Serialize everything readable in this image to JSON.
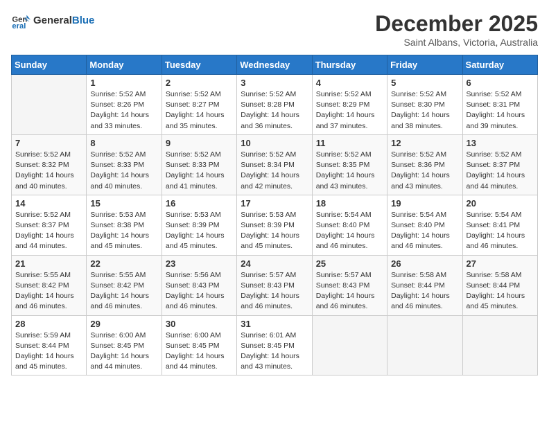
{
  "header": {
    "logo_general": "General",
    "logo_blue": "Blue",
    "month_title": "December 2025",
    "location": "Saint Albans, Victoria, Australia"
  },
  "weekdays": [
    "Sunday",
    "Monday",
    "Tuesday",
    "Wednesday",
    "Thursday",
    "Friday",
    "Saturday"
  ],
  "weeks": [
    [
      {
        "day": "",
        "info": ""
      },
      {
        "day": "1",
        "info": "Sunrise: 5:52 AM\nSunset: 8:26 PM\nDaylight: 14 hours\nand 33 minutes."
      },
      {
        "day": "2",
        "info": "Sunrise: 5:52 AM\nSunset: 8:27 PM\nDaylight: 14 hours\nand 35 minutes."
      },
      {
        "day": "3",
        "info": "Sunrise: 5:52 AM\nSunset: 8:28 PM\nDaylight: 14 hours\nand 36 minutes."
      },
      {
        "day": "4",
        "info": "Sunrise: 5:52 AM\nSunset: 8:29 PM\nDaylight: 14 hours\nand 37 minutes."
      },
      {
        "day": "5",
        "info": "Sunrise: 5:52 AM\nSunset: 8:30 PM\nDaylight: 14 hours\nand 38 minutes."
      },
      {
        "day": "6",
        "info": "Sunrise: 5:52 AM\nSunset: 8:31 PM\nDaylight: 14 hours\nand 39 minutes."
      }
    ],
    [
      {
        "day": "7",
        "info": "Sunrise: 5:52 AM\nSunset: 8:32 PM\nDaylight: 14 hours\nand 40 minutes."
      },
      {
        "day": "8",
        "info": "Sunrise: 5:52 AM\nSunset: 8:33 PM\nDaylight: 14 hours\nand 40 minutes."
      },
      {
        "day": "9",
        "info": "Sunrise: 5:52 AM\nSunset: 8:33 PM\nDaylight: 14 hours\nand 41 minutes."
      },
      {
        "day": "10",
        "info": "Sunrise: 5:52 AM\nSunset: 8:34 PM\nDaylight: 14 hours\nand 42 minutes."
      },
      {
        "day": "11",
        "info": "Sunrise: 5:52 AM\nSunset: 8:35 PM\nDaylight: 14 hours\nand 43 minutes."
      },
      {
        "day": "12",
        "info": "Sunrise: 5:52 AM\nSunset: 8:36 PM\nDaylight: 14 hours\nand 43 minutes."
      },
      {
        "day": "13",
        "info": "Sunrise: 5:52 AM\nSunset: 8:37 PM\nDaylight: 14 hours\nand 44 minutes."
      }
    ],
    [
      {
        "day": "14",
        "info": "Sunrise: 5:52 AM\nSunset: 8:37 PM\nDaylight: 14 hours\nand 44 minutes."
      },
      {
        "day": "15",
        "info": "Sunrise: 5:53 AM\nSunset: 8:38 PM\nDaylight: 14 hours\nand 45 minutes."
      },
      {
        "day": "16",
        "info": "Sunrise: 5:53 AM\nSunset: 8:39 PM\nDaylight: 14 hours\nand 45 minutes."
      },
      {
        "day": "17",
        "info": "Sunrise: 5:53 AM\nSunset: 8:39 PM\nDaylight: 14 hours\nand 45 minutes."
      },
      {
        "day": "18",
        "info": "Sunrise: 5:54 AM\nSunset: 8:40 PM\nDaylight: 14 hours\nand 46 minutes."
      },
      {
        "day": "19",
        "info": "Sunrise: 5:54 AM\nSunset: 8:40 PM\nDaylight: 14 hours\nand 46 minutes."
      },
      {
        "day": "20",
        "info": "Sunrise: 5:54 AM\nSunset: 8:41 PM\nDaylight: 14 hours\nand 46 minutes."
      }
    ],
    [
      {
        "day": "21",
        "info": "Sunrise: 5:55 AM\nSunset: 8:42 PM\nDaylight: 14 hours\nand 46 minutes."
      },
      {
        "day": "22",
        "info": "Sunrise: 5:55 AM\nSunset: 8:42 PM\nDaylight: 14 hours\nand 46 minutes."
      },
      {
        "day": "23",
        "info": "Sunrise: 5:56 AM\nSunset: 8:43 PM\nDaylight: 14 hours\nand 46 minutes."
      },
      {
        "day": "24",
        "info": "Sunrise: 5:57 AM\nSunset: 8:43 PM\nDaylight: 14 hours\nand 46 minutes."
      },
      {
        "day": "25",
        "info": "Sunrise: 5:57 AM\nSunset: 8:43 PM\nDaylight: 14 hours\nand 46 minutes."
      },
      {
        "day": "26",
        "info": "Sunrise: 5:58 AM\nSunset: 8:44 PM\nDaylight: 14 hours\nand 46 minutes."
      },
      {
        "day": "27",
        "info": "Sunrise: 5:58 AM\nSunset: 8:44 PM\nDaylight: 14 hours\nand 45 minutes."
      }
    ],
    [
      {
        "day": "28",
        "info": "Sunrise: 5:59 AM\nSunset: 8:44 PM\nDaylight: 14 hours\nand 45 minutes."
      },
      {
        "day": "29",
        "info": "Sunrise: 6:00 AM\nSunset: 8:45 PM\nDaylight: 14 hours\nand 44 minutes."
      },
      {
        "day": "30",
        "info": "Sunrise: 6:00 AM\nSunset: 8:45 PM\nDaylight: 14 hours\nand 44 minutes."
      },
      {
        "day": "31",
        "info": "Sunrise: 6:01 AM\nSunset: 8:45 PM\nDaylight: 14 hours\nand 43 minutes."
      },
      {
        "day": "",
        "info": ""
      },
      {
        "day": "",
        "info": ""
      },
      {
        "day": "",
        "info": ""
      }
    ]
  ]
}
